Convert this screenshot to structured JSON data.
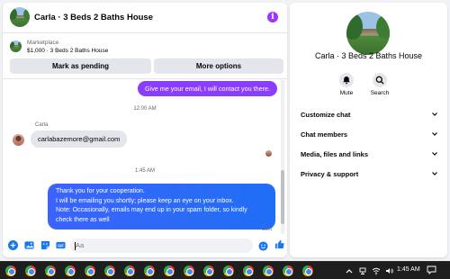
{
  "header": {
    "title": "Carla · 3 Beds 2 Baths House",
    "info_icon": "info-icon",
    "info_color": "#a033ff"
  },
  "listing": {
    "marketplace_label": "Marketplace",
    "price_title": "$1,000 · 3 Beds 2 Baths House",
    "mark_pending_label": "Mark as pending",
    "more_options_label": "More options"
  },
  "messages": {
    "outgoing_top": "Give me your email, I will contact you there.",
    "timestamp_1": "12:00 AM",
    "sender_name": "Carla",
    "incoming_email": "carlabazemore@gmail.com",
    "timestamp_2": "1:45 AM",
    "outgoing_main_lines": [
      "Thank you for your cooperation.",
      "I will be emailing you shortly; please keep an eye on your inbox.",
      "Note: Occasionally, emails may end up in your spam folder, so kindly",
      "check there as well"
    ],
    "sent_label": "Sent"
  },
  "composer": {
    "placeholder": "Aa",
    "icons": [
      "plus-icon",
      "image-icon",
      "sticker-icon",
      "gif-icon",
      "emoji-icon",
      "thumbs-up-icon"
    ],
    "accent": "#1877f2"
  },
  "side_panel": {
    "title": "Carla · 3 Beds 2 Baths House",
    "mute_label": "Mute",
    "search_label": "Search",
    "menu": [
      {
        "label": "Customize chat"
      },
      {
        "label": "Chat members"
      },
      {
        "label": "Media, files and links"
      },
      {
        "label": "Privacy & support"
      }
    ]
  },
  "taskbar": {
    "time": "1:45 AM",
    "app_icons": [
      "chrome-icon"
    ],
    "tray_icons": [
      "chevron-up-icon",
      "network-icon",
      "volume-icon",
      "notification-icon"
    ]
  }
}
